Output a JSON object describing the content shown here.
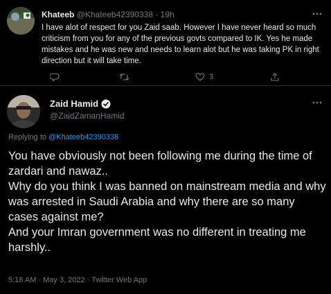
{
  "reply": {
    "name": "Khateeb",
    "handle": "@Khateeb42390338",
    "separator": "·",
    "time": "19h",
    "text": "I have alot of respect for you Zaid saab. However I have never heard so much criticism from you for any of the previous govts compared to IK. Yes he made mistakes and he was new and needs to learn alot but he was taking PK in right direction but it will take time.",
    "like_count": "3",
    "icons": [
      "reply-icon",
      "retweet-icon",
      "like-icon",
      "share-icon",
      "more-icon"
    ]
  },
  "main": {
    "name": "Zaid Hamid",
    "handle": "@ZaidZamanHamid",
    "replying_prefix": "Replying to ",
    "replying_mention": "@Khateeb42390338",
    "text": "You have obviously not been following me during the time of zardari and nawaz..\nWhy do you think I was banned on mainstream media and why was arrested in Saudi Arabia and why there are so many cases against me?\nAnd your Imran government was no different in treating me harshly..",
    "meta": "5:18 AM · May 3, 2022 · Twitter Web App",
    "verified_color": "#e7e9ea"
  },
  "colors": {
    "background": "#000000",
    "text": "#e7e9ea",
    "muted": "#71767b",
    "accent": "#1d9bf0",
    "divider": "#2f3336"
  }
}
